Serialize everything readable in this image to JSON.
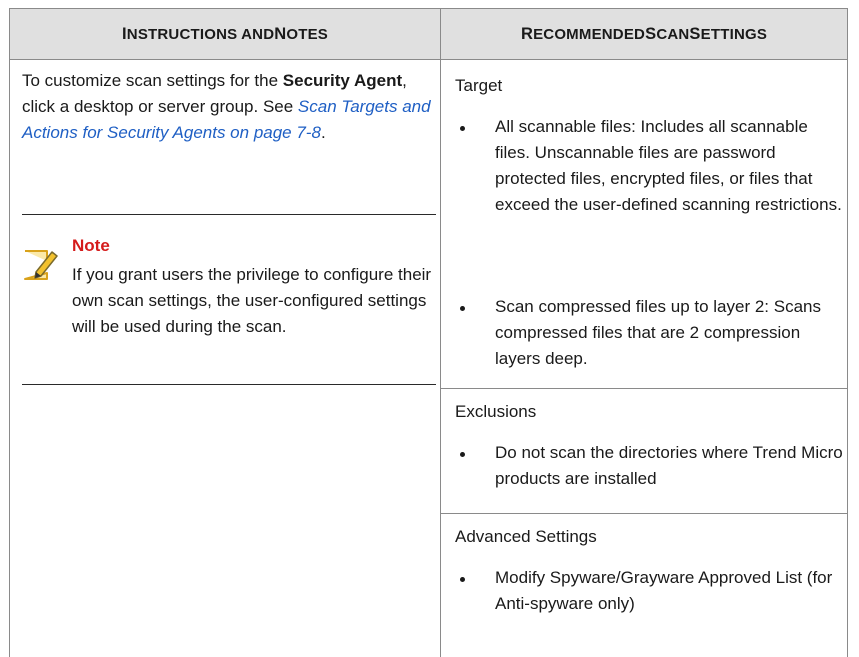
{
  "table": {
    "headers": {
      "left": {
        "first": "I",
        "rest_a": "nstructions and ",
        "second": "N",
        "rest_b": "otes"
      },
      "right": {
        "first": "R",
        "rest_a": "ecommended ",
        "second": "S",
        "rest_b": "can ",
        "third": "S",
        "rest_c": "ettings"
      }
    },
    "left": {
      "text_1": "To customize scan settings for the ",
      "text_bold": "Security Agent",
      "text_2": ", click a desktop or server group. See ",
      "link": "Scan Targets and Actions for Security Agents on page 7-8",
      "text_3": ".",
      "note": {
        "title": "Note",
        "text": "If you grant users the privilege to configure their own scan settings, the user-configured settings will be used during the scan."
      }
    },
    "right": {
      "sections": [
        {
          "title": "Target",
          "items": [
            "All scannable files: Includes all scannable files. Unscannable files are password protected files, encrypted files, or files that exceed the user-defined scanning restrictions.",
            "Scan compressed files up to layer 2: Scans compressed files that are 2 compression layers deep."
          ]
        },
        {
          "title": "Exclusions",
          "items": [
            "Do not scan the directories where Trend Micro products are installed"
          ]
        },
        {
          "title": "Advanced Settings",
          "items": [
            "Modify Spyware/Grayware Approved List (for Anti-spyware only)"
          ]
        }
      ]
    }
  },
  "colors": {
    "link": "#1f5fc4",
    "note_title": "#d51b1b",
    "header_bg": "#e0e0e0",
    "note_icon": "#f2c12e"
  },
  "icons": {
    "note": "note-pencil-icon"
  }
}
